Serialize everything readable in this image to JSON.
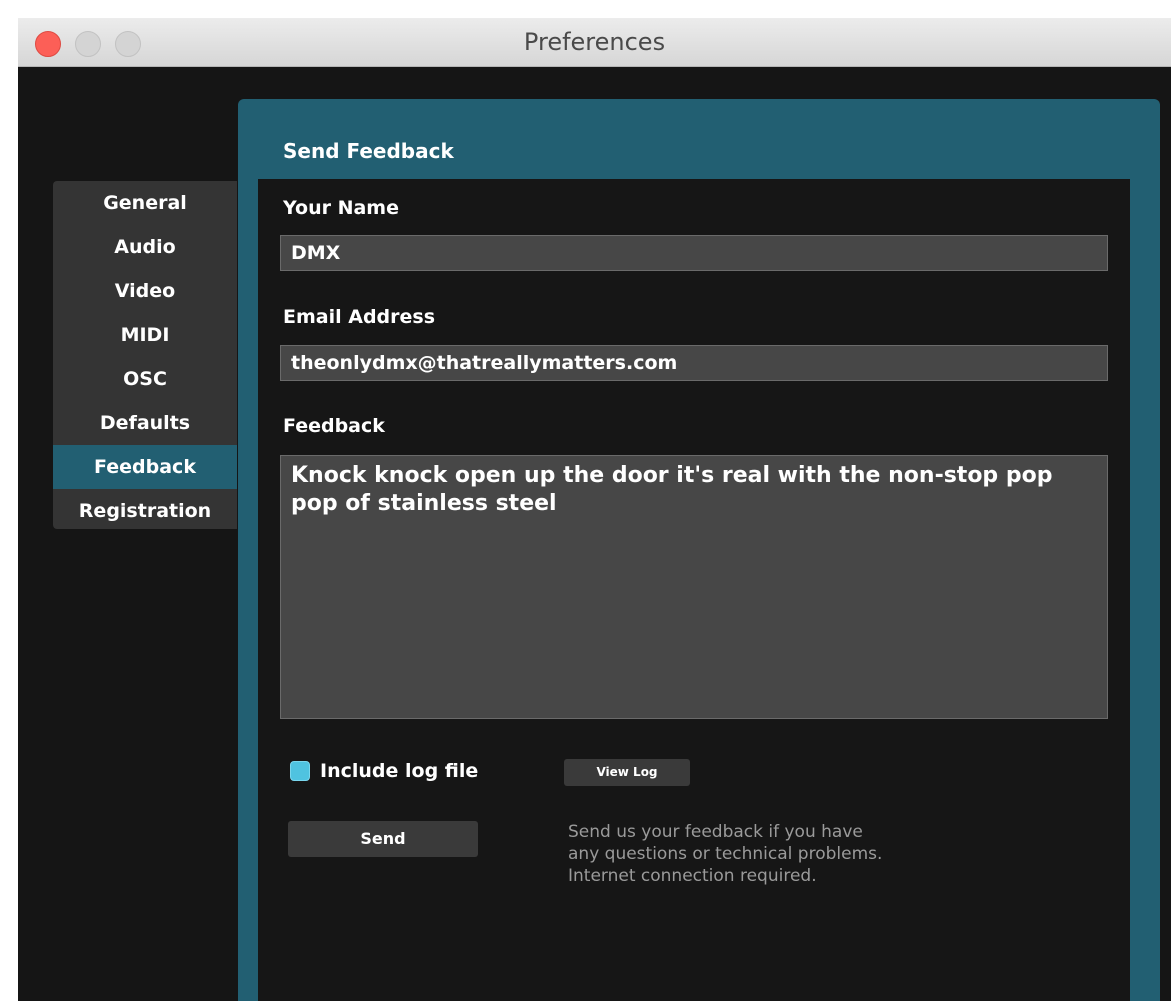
{
  "window": {
    "title": "Preferences"
  },
  "sidebar": {
    "items": [
      {
        "label": "General",
        "active": false
      },
      {
        "label": "Audio",
        "active": false
      },
      {
        "label": "Video",
        "active": false
      },
      {
        "label": "MIDI",
        "active": false
      },
      {
        "label": "OSC",
        "active": false
      },
      {
        "label": "Defaults",
        "active": false
      },
      {
        "label": "Feedback",
        "active": true
      },
      {
        "label": "Registration",
        "active": false
      }
    ]
  },
  "feedback_form": {
    "panel_title": "Send Feedback",
    "name_label": "Your Name",
    "name_value": "DMX",
    "email_label": "Email Address",
    "email_value": "theonlydmx@thatreallymatters.com",
    "feedback_label": "Feedback",
    "feedback_value": "Knock knock open up the door it's real with the non-stop pop pop of stainless steel",
    "include_log_label": "Include log file",
    "include_log_checked": true,
    "view_log_label": "View Log",
    "send_label": "Send",
    "help_text": "Send us your feedback if you have any questions or technical problems. Internet connection required."
  },
  "colors": {
    "accent": "#225f72",
    "checkbox": "#4fc3e0",
    "background": "#151515",
    "field": "#474747"
  }
}
